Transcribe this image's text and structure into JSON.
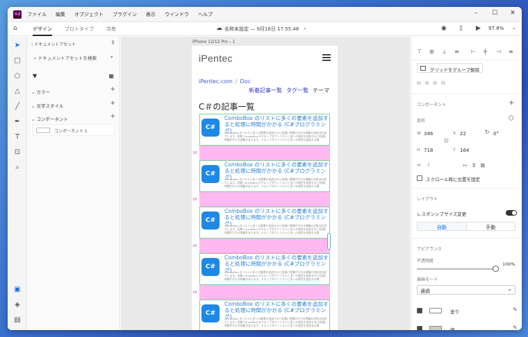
{
  "app": {
    "logo": "Xd",
    "menu": [
      "ファイル",
      "編集",
      "オブジェクト",
      "プラグイン",
      "表示",
      "ウインドウ",
      "ヘルプ"
    ]
  },
  "toolbar": {
    "tabs": [
      "デザイン",
      "プロトタイプ",
      "共有"
    ],
    "doc_title": "名称未設定 — 9月16日 17.55.48",
    "zoom": "97.8%"
  },
  "assets": {
    "header": "ドキュメントアセット",
    "search_placeholder": "ドキュメントアセットを検索",
    "sections": [
      "カラー",
      "文字スタイル",
      "コンポーネント"
    ],
    "component_item": "コンポーネント 1"
  },
  "canvas": {
    "artboard_label": "iPhone 12/12 Pro – 1",
    "brand": "iPentec",
    "breadcrumb": [
      "iPentec.com",
      "Doc"
    ],
    "nav": [
      "新着記事一覧",
      "タグ一覧",
      "テーマ"
    ],
    "heading": "C＃の記事一覧",
    "card_icon": "C#",
    "card_title": "ComboBox のリストに多くの要素を追加すると処理に時間がかかる (C#プログラミング)",
    "card_desc": "ComboBox のリストに多くの要素を追加すると処理に時間がかかる現象の対処法を紹介します。初期 ComboBox のドロップダウンリストに多くの項目を追加すると処理に時間がかかる現象があります。ドロップダウンリストに多くの項目を追加する場",
    "gap_label": "18",
    "card_count": 5
  },
  "properties": {
    "ungroup_label": "グリッドをグループ解除",
    "component_label": "コンポーネント",
    "transform_label": "変形",
    "w": "346",
    "x": "22",
    "h": "718",
    "y": "164",
    "rotation": "0°",
    "fix_scroll": "スクロール時に位置を固定",
    "layout_label": "レイアウト",
    "responsive_label": "レスポンシブサイズ変更",
    "auto": "自動",
    "manual": "手動",
    "appearance_label": "アピアランス",
    "opacity_label": "不透明度",
    "opacity": "100%",
    "blend_label": "描画モード",
    "blend": "通過",
    "fill_label": "塗り",
    "stroke_label": "線",
    "fill_hex": "#ffffff",
    "stroke_hex": "#cccccc"
  }
}
